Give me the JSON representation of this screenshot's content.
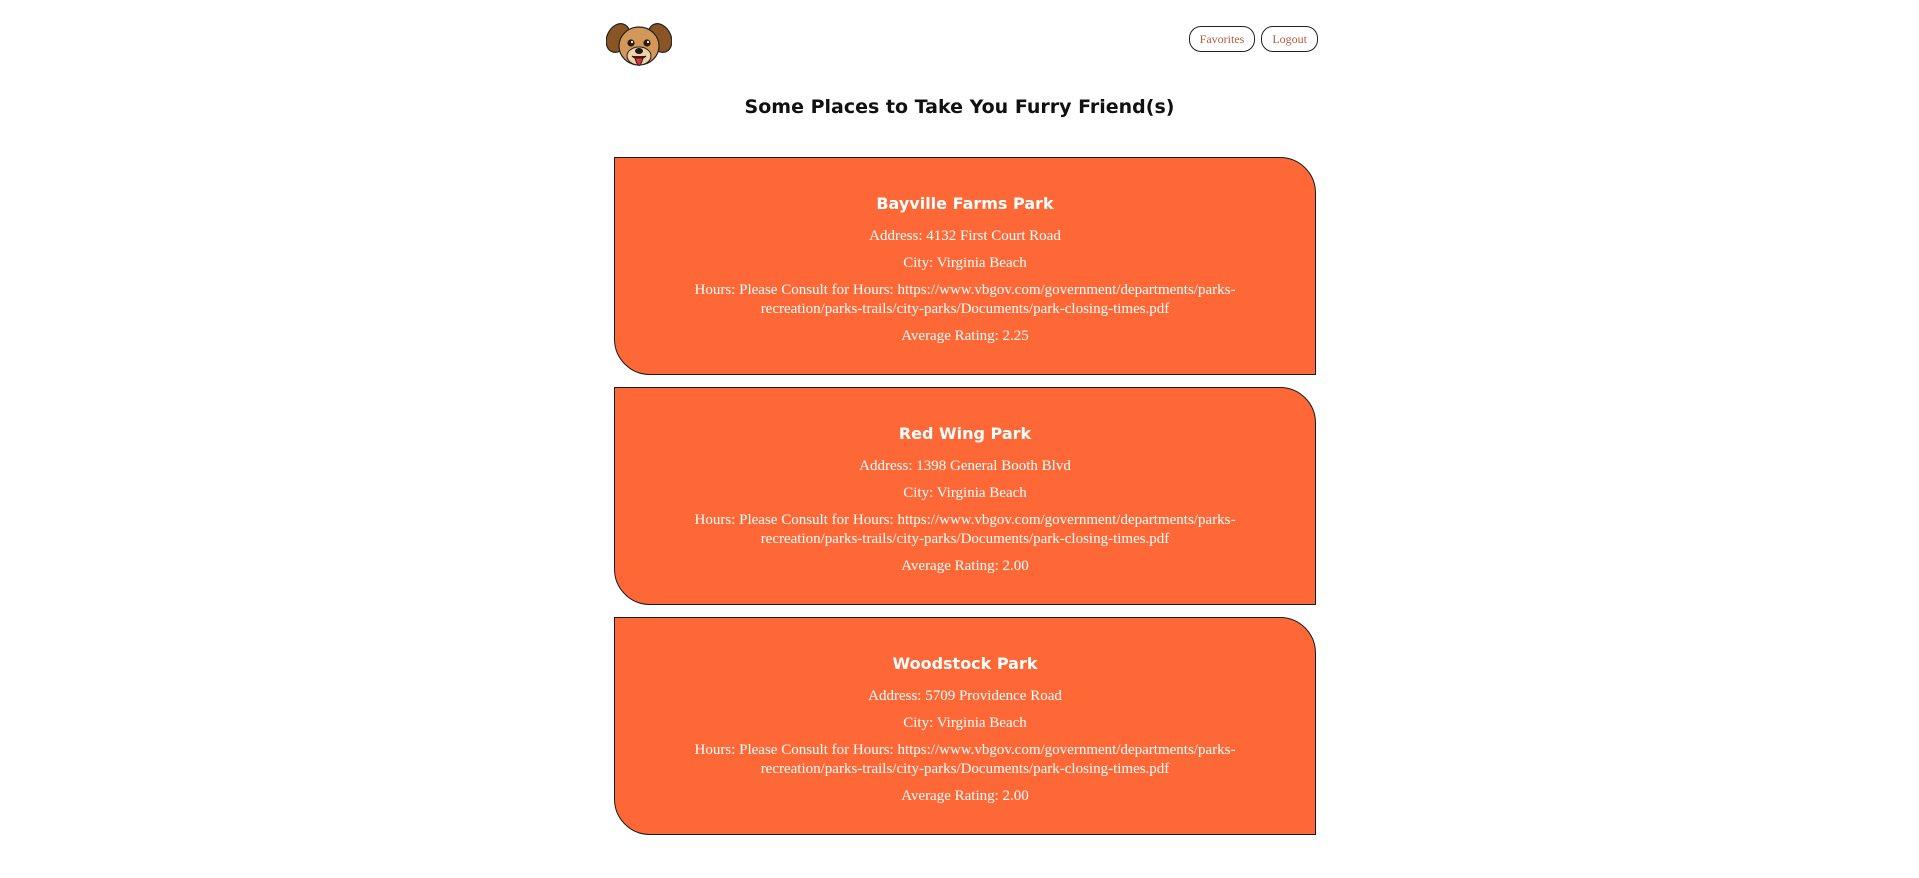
{
  "header": {
    "favorites_label": "Favorites",
    "logout_label": "Logout"
  },
  "page": {
    "title": "Some Places to Take You Furry Friend(s)"
  },
  "parks": [
    {
      "name": "Bayville Farms Park",
      "address": "Address: 4132 First Court Road",
      "city": "City: Virginia Beach",
      "hours": "Hours: Please Consult for Hours: https://www.vbgov.com/government/departments/parks-recreation/parks-trails/city-parks/Documents/park-closing-times.pdf",
      "rating": "Average Rating: 2.25"
    },
    {
      "name": "Red Wing Park",
      "address": "Address: 1398 General Booth Blvd",
      "city": "City: Virginia Beach",
      "hours": "Hours: Please Consult for Hours: https://www.vbgov.com/government/departments/parks-recreation/parks-trails/city-parks/Documents/park-closing-times.pdf",
      "rating": "Average Rating: 2.00"
    },
    {
      "name": "Woodstock Park",
      "address": "Address: 5709 Providence Road",
      "city": "City: Virginia Beach",
      "hours": "Hours: Please Consult for Hours: https://www.vbgov.com/government/departments/parks-recreation/parks-trails/city-parks/Documents/park-closing-times.pdf",
      "rating": "Average Rating: 2.00"
    }
  ],
  "colors": {
    "card_background": "#fe6836",
    "nav_text": "#b8583a"
  },
  "icons": {
    "logo": "dog-face-icon"
  }
}
